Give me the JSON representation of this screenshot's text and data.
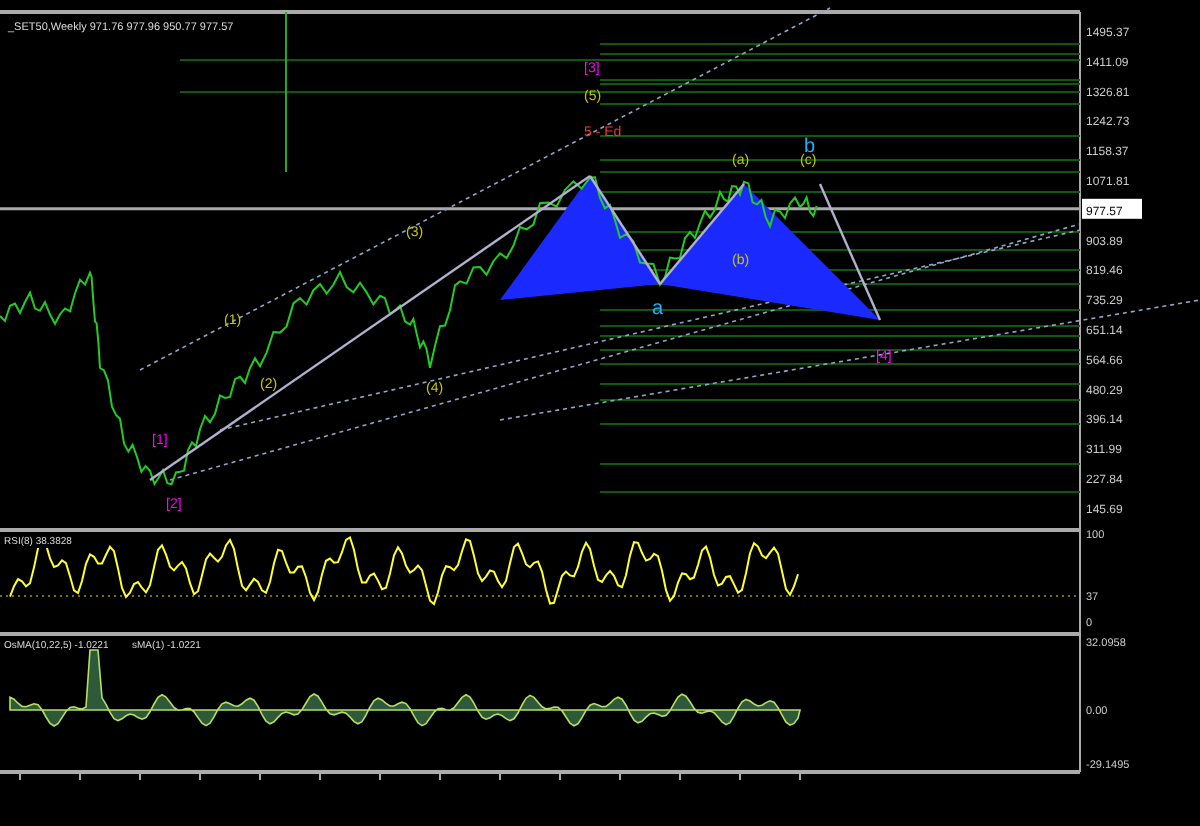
{
  "chart_title": "_SET50,Weekly  971.76 977.96 950.77 977.57",
  "price_axis": [
    {
      "text": "1495.37",
      "current": false
    },
    {
      "text": "1411.09",
      "current": false
    },
    {
      "text": "1326.81",
      "current": false
    },
    {
      "text": "1242.73",
      "current": false
    },
    {
      "text": "1158.37",
      "current": false
    },
    {
      "text": "1071.81",
      "current": false
    },
    {
      "text": "977.57",
      "current": true
    },
    {
      "text": "903.89",
      "current": false
    },
    {
      "text": "819.46",
      "current": false
    },
    {
      "text": "735.29",
      "current": false
    },
    {
      "text": "651.14",
      "current": false
    },
    {
      "text": "564.66",
      "current": false
    },
    {
      "text": "480.29",
      "current": false
    },
    {
      "text": "396.14",
      "current": false
    },
    {
      "text": "311.99",
      "current": false
    },
    {
      "text": "227.84",
      "current": false
    },
    {
      "text": "145.69",
      "current": false
    }
  ],
  "wave_labels": [
    {
      "text": "[1]",
      "color": "#ff00ff"
    },
    {
      "text": "[2]",
      "color": "#ff00ff"
    },
    {
      "text": "[3]",
      "color": "#ff00ff"
    },
    {
      "text": "[4]",
      "color": "#ff00ff"
    },
    {
      "text": "(1)",
      "color": "#c8c800"
    },
    {
      "text": "(2)",
      "color": "#c8c800"
    },
    {
      "text": "(3)",
      "color": "#c8c800"
    },
    {
      "text": "(4)",
      "color": "#c8c800"
    },
    {
      "text": "(5)",
      "color": "#c8c800"
    },
    {
      "text": "5 - Ed",
      "color": "#ff3030"
    },
    {
      "text": "(a)",
      "color": "#c8c800"
    },
    {
      "text": "(b)",
      "color": "#c8c800"
    },
    {
      "text": "(c)",
      "color": "#c8c800"
    },
    {
      "text": "a",
      "color": "#20b0ff"
    },
    {
      "text": "b",
      "color": "#20b0ff"
    }
  ],
  "rsi": {
    "label": "RSI(8) 38.3828",
    "axis": [
      "100",
      "37",
      "0"
    ]
  },
  "osma": {
    "label": "OsMA(10,22,5) -1.0221",
    "label_2": "sMA(1) -1.0221",
    "axis": [
      "32.0958",
      "0.00",
      "-29.1495"
    ]
  }
}
